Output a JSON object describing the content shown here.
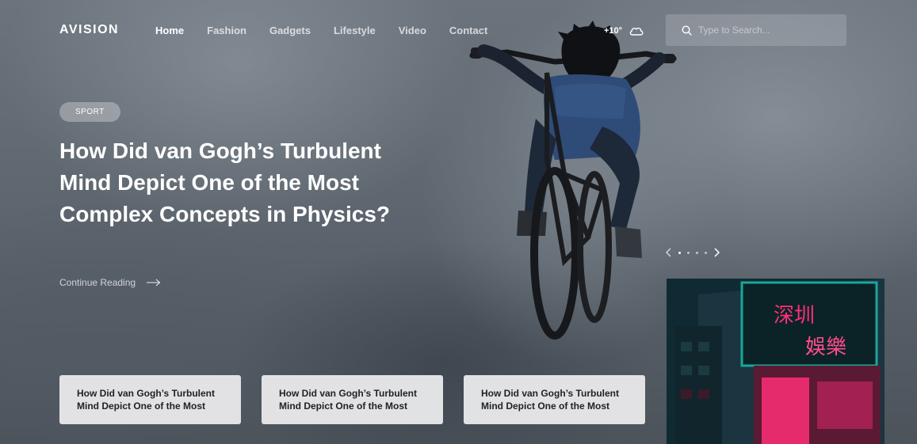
{
  "brand": {
    "logo": "AVISION"
  },
  "nav": {
    "items": [
      {
        "label": "Home",
        "active": true
      },
      {
        "label": "Fashion"
      },
      {
        "label": "Gadgets"
      },
      {
        "label": "Lifestyle"
      },
      {
        "label": "Video"
      },
      {
        "label": "Contact"
      }
    ]
  },
  "weather": {
    "temperature": "+10°",
    "icon": "cloud-icon"
  },
  "search": {
    "placeholder": "Type to Search...",
    "value": ""
  },
  "hero": {
    "tag": "SPORT",
    "title": "How Did van Gogh’s Turbulent Mind Depict One of the Most Complex Concepts in Physics?",
    "cta": "Continue Reading"
  },
  "slider": {
    "current_slide": 1,
    "slide_count": 4
  },
  "thumbnail": {
    "sign_text": [
      "深圳",
      "娛樂"
    ]
  },
  "cards": [
    {
      "title": "How Did van Gogh’s Turbulent Mind Depict One of the Most"
    },
    {
      "title": "How Did van Gogh’s Turbulent Mind Depict One of the Most"
    },
    {
      "title": "How Did van Gogh’s Turbulent Mind Depict One of the Most"
    }
  ],
  "colors": {
    "card_bg": "#e8e8ea",
    "neon_pink": "#ff2f77",
    "neon_teal": "#1ba69a"
  }
}
